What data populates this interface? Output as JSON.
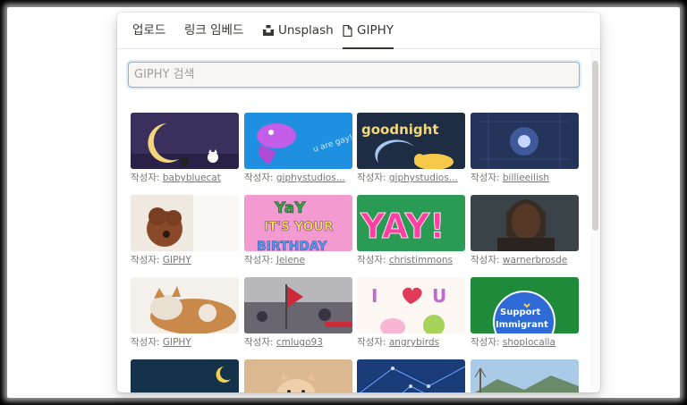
{
  "tabs": [
    {
      "label": "업로드",
      "icon": null
    },
    {
      "label": "링크 임베드",
      "icon": null
    },
    {
      "label": "Unsplash",
      "icon": "unsplash-icon"
    },
    {
      "label": "GIPHY",
      "icon": "file-icon",
      "active": true
    }
  ],
  "search": {
    "placeholder": "GIPHY 검색",
    "value": ""
  },
  "caption_prefix": "작성자: ",
  "gifs": [
    {
      "author": "babybluecat",
      "thumb": "sleepy-moon-cat-icon"
    },
    {
      "author": "giphystudios...",
      "thumb": "purple-fish-icon"
    },
    {
      "author": "giphystudios...",
      "thumb": "goodnight-moon-icon"
    },
    {
      "author": "billieeilish",
      "thumb": "blue-glow-icon"
    },
    {
      "author": "GIPHY",
      "thumb": "dog-photo-icon"
    },
    {
      "author": "Jelene",
      "thumb": "yay-birthday-icon"
    },
    {
      "author": "christimmons",
      "thumb": "yay-text-icon"
    },
    {
      "author": "warnerbrosde",
      "thumb": "man-portrait-icon"
    },
    {
      "author": "GIPHY",
      "thumb": "cat-photo-icon"
    },
    {
      "author": "cmlugo93",
      "thumb": "flag-crowd-icon"
    },
    {
      "author": "angrybirds",
      "thumb": "i-love-u-icon"
    },
    {
      "author": "shoplocalla",
      "thumb": "support-immigrant-icon"
    },
    {
      "author": "",
      "thumb": "good-night-text-icon"
    },
    {
      "author": "",
      "thumb": "kitten-photo-icon"
    },
    {
      "author": "",
      "thumb": "blue-network-icon"
    },
    {
      "author": "",
      "thumb": "landscape-icon"
    }
  ]
}
